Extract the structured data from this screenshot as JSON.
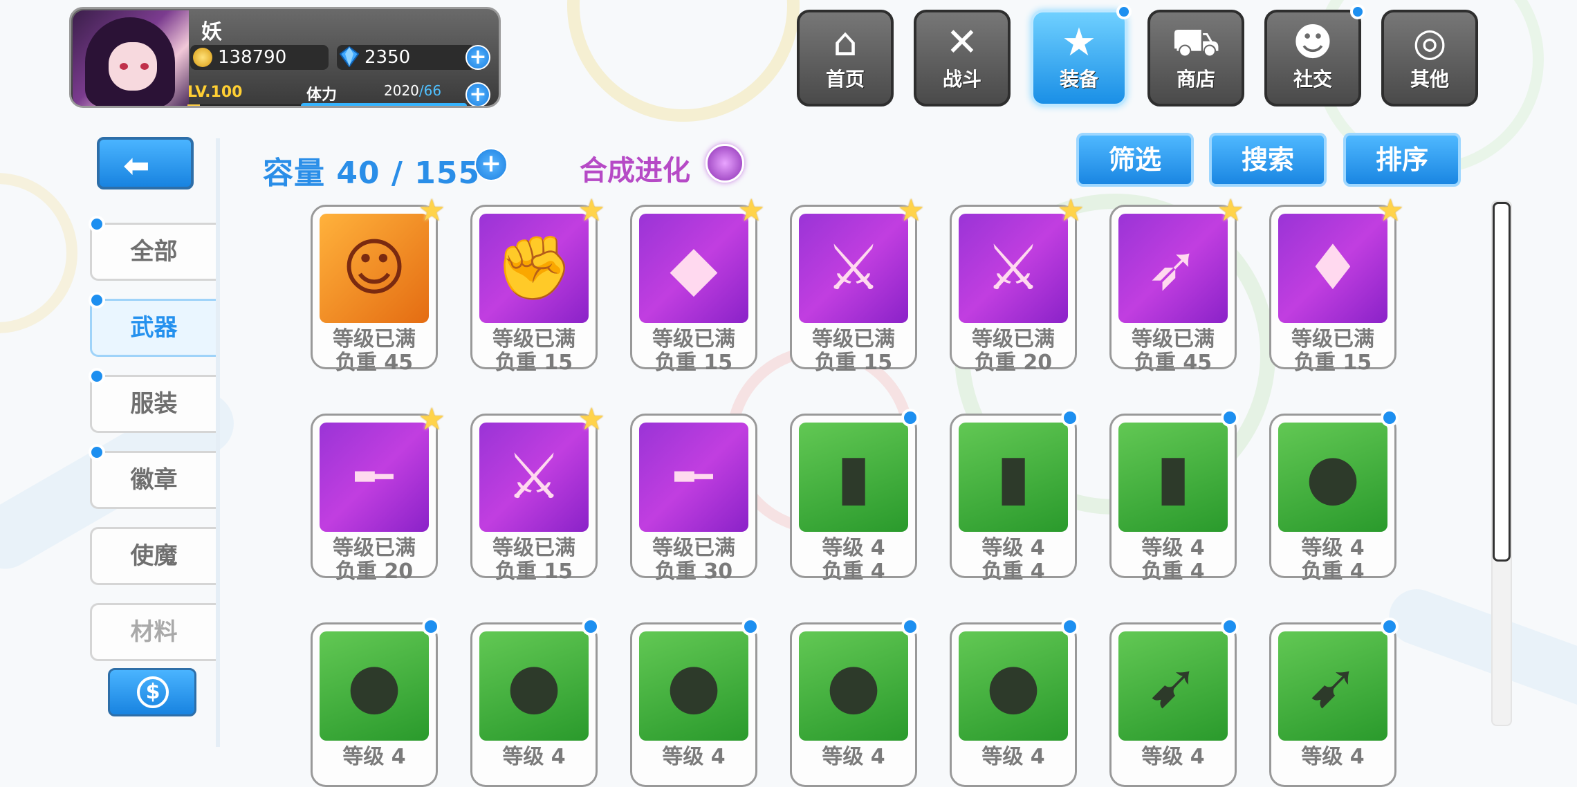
{
  "player": {
    "name": "妖",
    "gold": "138790",
    "gems": "2350",
    "level": "LV.100",
    "level_progress": 0.08,
    "stamina_label": "体力",
    "stamina_current": "2020",
    "stamina_max": "/66",
    "stamina_progress": 1.0
  },
  "nav": [
    {
      "label": "首页",
      "icon": "house-icon",
      "active": false,
      "dot": false
    },
    {
      "label": "战斗",
      "icon": "crossed-guns-icon",
      "active": false,
      "dot": false
    },
    {
      "label": "装备",
      "icon": "star-gun-icon",
      "active": true,
      "dot": true
    },
    {
      "label": "商店",
      "icon": "shop-basket-icon",
      "active": false,
      "dot": false
    },
    {
      "label": "社交",
      "icon": "ghost-face-icon",
      "active": false,
      "dot": true
    },
    {
      "label": "其他",
      "icon": "target-icon",
      "active": false,
      "dot": false
    }
  ],
  "sidebar": [
    {
      "label": "全部",
      "active": false,
      "dot": true,
      "dim": false
    },
    {
      "label": "武器",
      "active": true,
      "dot": true,
      "dim": false
    },
    {
      "label": "服装",
      "active": false,
      "dot": true,
      "dim": false
    },
    {
      "label": "徽章",
      "active": false,
      "dot": true,
      "dim": false
    },
    {
      "label": "使魔",
      "active": false,
      "dot": false,
      "dim": false
    },
    {
      "label": "材料",
      "active": false,
      "dot": false,
      "dim": true
    }
  ],
  "capacity": {
    "text": "容量 40 / 155"
  },
  "synthesis": {
    "text": "合成进化"
  },
  "actions": {
    "filter": "筛选",
    "search": "搜索",
    "sort": "排序"
  },
  "items": [
    {
      "line1": "等级已满",
      "line2": "负重 45",
      "bg": "orange",
      "icon": "chibi-girl-icon",
      "glyph": "☺",
      "badge": "star"
    },
    {
      "line1": "等级已满",
      "line2": "负重 15",
      "bg": "purple",
      "icon": "fist-icon",
      "glyph": "✊",
      "badge": "star"
    },
    {
      "line1": "等级已满",
      "line2": "负重 15",
      "bg": "purple",
      "icon": "crystal-cluster-icon",
      "glyph": "◆",
      "badge": "star"
    },
    {
      "line1": "等级已满",
      "line2": "负重 15",
      "bg": "purple",
      "icon": "dark-blade-icon",
      "glyph": "⚔",
      "badge": "star"
    },
    {
      "line1": "等级已满",
      "line2": "负重 20",
      "bg": "purple",
      "icon": "thorn-sword-icon",
      "glyph": "⚔",
      "badge": "star"
    },
    {
      "line1": "等级已满",
      "line2": "负重 45",
      "bg": "purple",
      "icon": "lance-icon",
      "glyph": "➶",
      "badge": "star"
    },
    {
      "line1": "等级已满",
      "line2": "负重 15",
      "bg": "purple",
      "icon": "red-gem-icon",
      "glyph": "♦",
      "badge": "star"
    },
    {
      "line1": "等级已满",
      "line2": "负重 20",
      "bg": "purple",
      "icon": "red-rifle-icon",
      "glyph": "╾",
      "badge": "star"
    },
    {
      "line1": "等级已满",
      "line2": "负重 15",
      "bg": "purple",
      "icon": "red-pistol-blade-icon",
      "glyph": "⚔",
      "badge": "star"
    },
    {
      "line1": "等级已满",
      "line2": "负重 30",
      "bg": "purple",
      "icon": "ornate-rifle-icon",
      "glyph": "╾",
      "badge": "none"
    },
    {
      "line1": "等级 4",
      "line2": "负重 4",
      "bg": "green",
      "icon": "spray-can-icon",
      "glyph": "▮",
      "badge": "dot"
    },
    {
      "line1": "等级 4",
      "line2": "负重 4",
      "bg": "green",
      "icon": "spray-can-icon",
      "glyph": "▮",
      "badge": "dot"
    },
    {
      "line1": "等级 4",
      "line2": "负重 4",
      "bg": "green",
      "icon": "spray-can-icon",
      "glyph": "▮",
      "badge": "dot"
    },
    {
      "line1": "等级 4",
      "line2": "负重 4",
      "bg": "green",
      "icon": "grenade-icon",
      "glyph": "●",
      "badge": "dot"
    },
    {
      "line1": "等级 4",
      "line2": "",
      "bg": "green",
      "icon": "grenade-icon",
      "glyph": "●",
      "badge": "dot"
    },
    {
      "line1": "等级 4",
      "line2": "",
      "bg": "green",
      "icon": "grenade-icon",
      "glyph": "●",
      "badge": "dot"
    },
    {
      "line1": "等级 4",
      "line2": "",
      "bg": "green",
      "icon": "grenade-icon",
      "glyph": "●",
      "badge": "dot"
    },
    {
      "line1": "等级 4",
      "line2": "",
      "bg": "green",
      "icon": "grenade-icon",
      "glyph": "●",
      "badge": "dot"
    },
    {
      "line1": "等级 4",
      "line2": "",
      "bg": "green",
      "icon": "grenade-icon",
      "glyph": "●",
      "badge": "dot"
    },
    {
      "line1": "等级 4",
      "line2": "",
      "bg": "green",
      "icon": "rocket-launcher-icon",
      "glyph": "➹",
      "badge": "dot"
    },
    {
      "line1": "等级 4",
      "line2": "",
      "bg": "green",
      "icon": "rocket-launcher-icon",
      "glyph": "➹",
      "badge": "dot"
    }
  ],
  "colors": {
    "accent": "#1a86e2",
    "synthesis": "#b64ac6",
    "card_purple": "#b23ad8",
    "card_green": "#4cb844"
  }
}
